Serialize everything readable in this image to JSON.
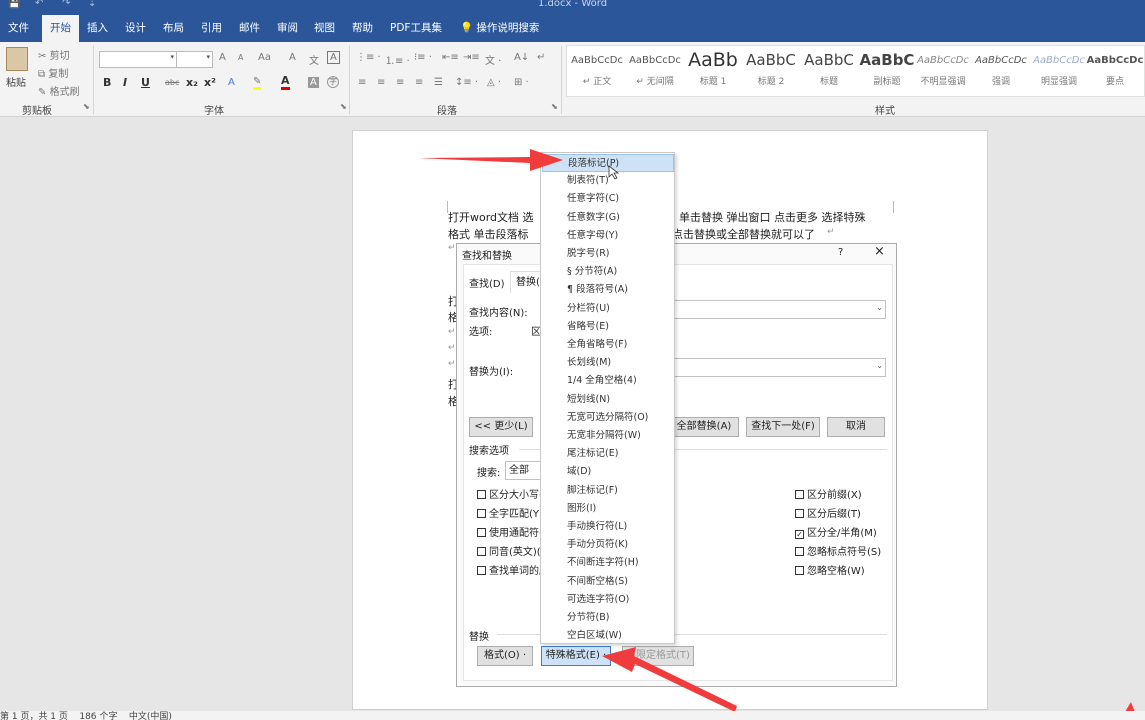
{
  "titlebar": {
    "title": "1.docx  -  Word",
    "qat": [
      "💾",
      "↶",
      "↷",
      "⇣"
    ]
  },
  "tabs": [
    "文件",
    "开始",
    "插入",
    "设计",
    "布局",
    "引用",
    "邮件",
    "审阅",
    "视图",
    "帮助",
    "PDF工具集"
  ],
  "active_tab": "开始",
  "tell_me": "操作说明搜索",
  "ribbon": {
    "clipboard": {
      "paste": "粘贴",
      "cut": "剪切",
      "copy": "复制",
      "painter": "格式刷",
      "label": "剪贴板"
    },
    "font": {
      "label": "字体",
      "row2": [
        "B",
        "I",
        "U",
        "abc",
        "x₂",
        "x²"
      ]
    },
    "paragraph": {
      "label": "段落"
    },
    "styles": {
      "label": "样式",
      "items": [
        {
          "preview": "AaBbCcDc",
          "name": "↵ 正文"
        },
        {
          "preview": "AaBbCcDc",
          "name": "↵ 无间隔"
        },
        {
          "preview": "AaBb",
          "name": "标题 1"
        },
        {
          "preview": "AaBbC",
          "name": "标题 2"
        },
        {
          "preview": "AaBbC",
          "name": "标题"
        },
        {
          "preview": "AaBbC",
          "name": "副标题"
        },
        {
          "preview": "AaBbCcDc",
          "name": "不明显强调"
        },
        {
          "preview": "AaBbCcDc",
          "name": "强调"
        },
        {
          "preview": "AaBbCcDc",
          "name": "明显强调"
        },
        {
          "preview": "AaBbCcDc",
          "name": "要点"
        }
      ]
    }
  },
  "document": {
    "line1a": "打开word文档  选",
    "line1b": "单击替换  弹出窗口  点击更多  选择特殊",
    "line2a": "格式  单击段落标",
    "line2b": "点击替换或全部替换就可以了",
    "para_mark": "↵",
    "frag": [
      "打",
      "格",
      "打",
      "格"
    ]
  },
  "dialog": {
    "title": "查找和替换",
    "help": "?",
    "close": "×",
    "tab_find": "查找(D)",
    "tab_replace": "替换(P)",
    "find_label": "查找内容(N):",
    "options_label": "选项:",
    "options_value": "区",
    "replace_label": "替换为(I):",
    "less_btn": "<< 更少(L)",
    "replace_all_btn": "全部替换(A)",
    "find_next_btn": "查找下一处(F)",
    "cancel_btn": "取消",
    "search_options": "搜索选项",
    "search_label": "搜索:",
    "search_value": "全部",
    "left_checks": [
      "区分大小写(H)",
      "全字匹配(Y)",
      "使用通配符(U)",
      "同音(英文)(K)",
      "查找单词的所有形式(英文)(W)"
    ],
    "right_checks": [
      {
        "label": "区分前缀(X)",
        "checked": false
      },
      {
        "label": "区分后缀(T)",
        "checked": false
      },
      {
        "label": "区分全/半角(M)",
        "checked": true
      },
      {
        "label": "忽略标点符号(S)",
        "checked": false
      },
      {
        "label": "忽略空格(W)",
        "checked": false
      }
    ],
    "replace_section": "替换",
    "format_btn": "格式(O) ·",
    "special_btn": "特殊格式(E) ·",
    "no_format_btn": "不限定格式(T)"
  },
  "menu": {
    "items": [
      "段落标记(P)",
      "制表符(T)",
      "任意字符(C)",
      "任意数字(G)",
      "任意字母(Y)",
      "脱字号(R)",
      "§ 分节符(A)",
      "¶ 段落符号(A)",
      "分栏符(U)",
      "省略号(E)",
      "全角省略号(F)",
      "长划线(M)",
      "1/4 全角空格(4)",
      "短划线(N)",
      "无宽可选分隔符(O)",
      "无宽非分隔符(W)",
      "尾注标记(E)",
      "域(D)",
      "脚注标记(F)",
      "图形(I)",
      "手动换行符(L)",
      "手动分页符(K)",
      "不间断连字符(H)",
      "不间断空格(S)",
      "可选连字符(O)",
      "分节符(B)",
      "空白区域(W)"
    ],
    "highlight": 0
  },
  "status": {
    "text": "第 1 页，共 1 页    186 个字    中文(中国)"
  },
  "colors": {
    "accent": "#2b579a",
    "arrow": "#f03c3c"
  }
}
